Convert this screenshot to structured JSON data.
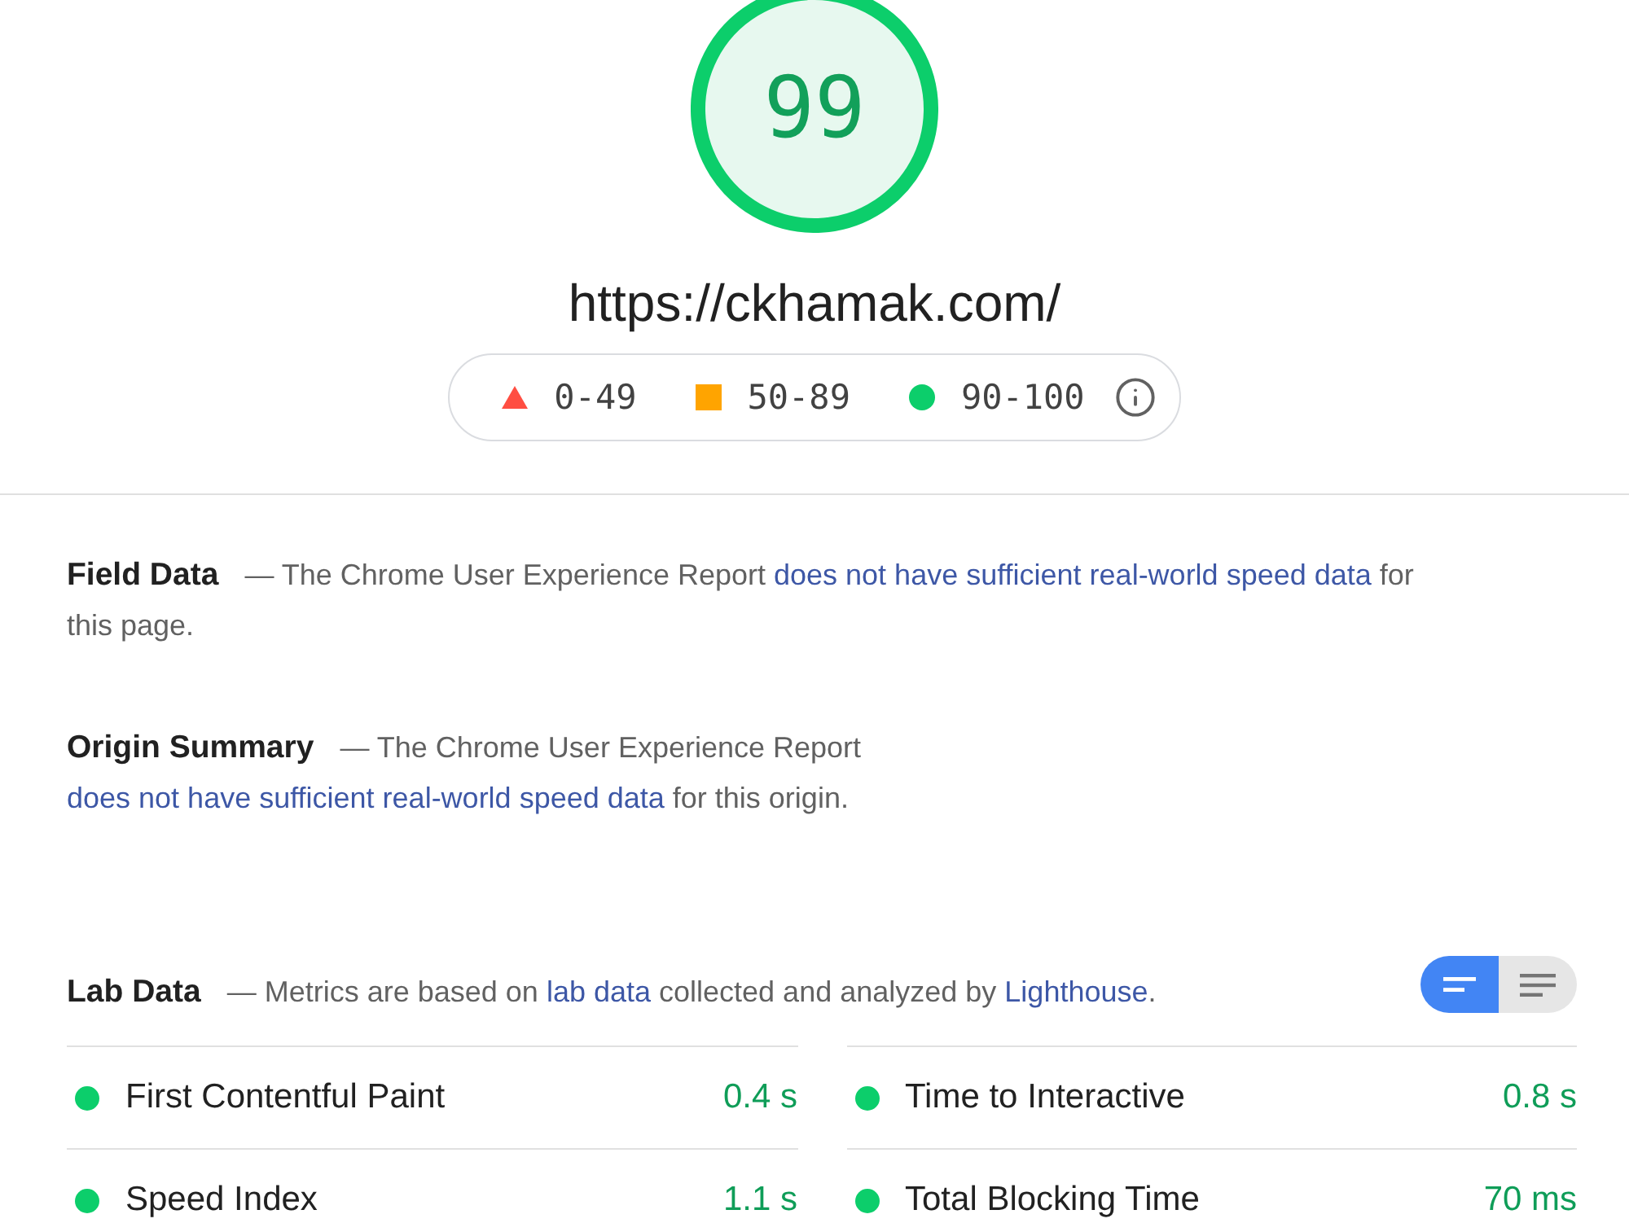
{
  "score": {
    "value": "99",
    "level": 0.99,
    "kind": "pass"
  },
  "url": "https://ckhamak.com/",
  "legend": [
    {
      "kind": "fail",
      "label": "0-49"
    },
    {
      "kind": "average",
      "label": "50-89"
    },
    {
      "kind": "pass",
      "label": "90-100"
    }
  ],
  "field_data": {
    "title": "Field Data",
    "description": [
      {
        "kind": "text",
        "text": "— The Chrome User Experience Report "
      },
      {
        "kind": "link",
        "text": "does not have sufficient real-world speed data"
      },
      {
        "kind": "text",
        "text": " for this page."
      }
    ]
  },
  "origin_summary": {
    "title": "Origin Summary",
    "description": [
      {
        "kind": "text",
        "text": "— The Chrome User Experience Report "
      },
      {
        "kind": "link",
        "text": "does not have sufficient real-world speed data"
      },
      {
        "kind": "text",
        "text": " for this origin."
      }
    ]
  },
  "lab_data": {
    "title": "Lab Data",
    "description": [
      {
        "kind": "text",
        "text": "— Metrics are based on "
      },
      {
        "kind": "link",
        "text": "lab data"
      },
      {
        "kind": "text",
        "text": " collected and analyzed by "
      },
      {
        "kind": "link",
        "text": "Lighthouse"
      },
      {
        "kind": "text",
        "text": "."
      }
    ],
    "view_toggle": [
      {
        "kind": "summary",
        "selected": true
      },
      {
        "kind": "details",
        "selected": false
      }
    ],
    "metrics": [
      {
        "label": "First Contentful Paint",
        "value": "0.4 s",
        "kind": "pass"
      },
      {
        "label": "Time to Interactive",
        "value": "0.8 s",
        "kind": "pass"
      },
      {
        "label": "Speed Index",
        "value": "1.1 s",
        "kind": "pass"
      },
      {
        "label": "Total Blocking Time",
        "value": "70 ms",
        "kind": "pass"
      }
    ]
  }
}
